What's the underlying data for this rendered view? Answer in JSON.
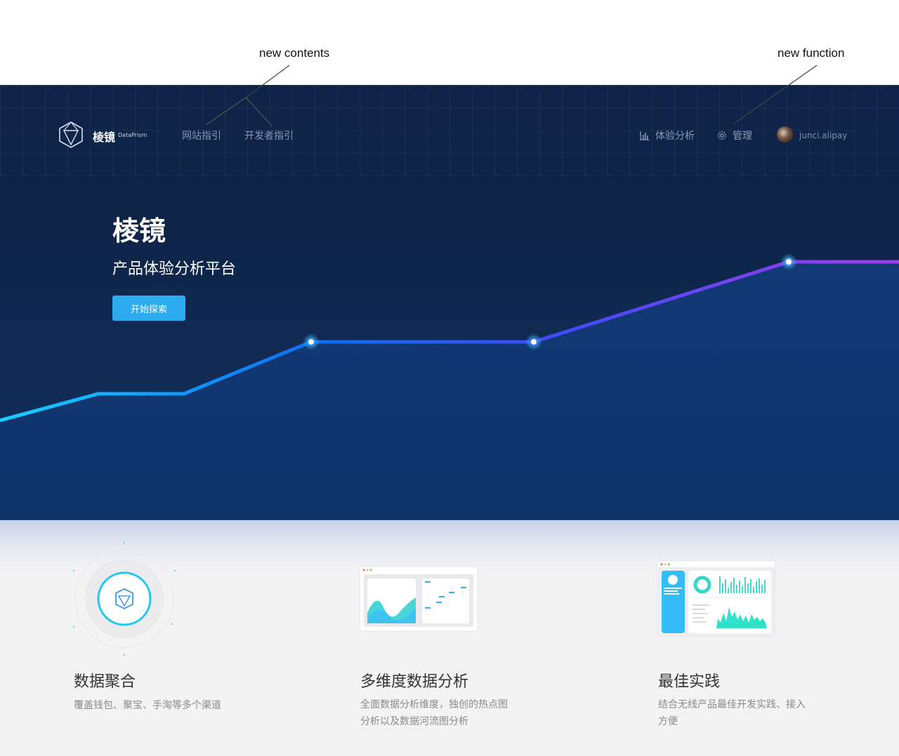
{
  "annotations": {
    "left": "new contents",
    "right": "new function"
  },
  "nav": {
    "brand": "棱镜",
    "brand_sub": "DataPrism",
    "links": [
      "网站指引",
      "开发者指引"
    ],
    "analytics_label": "体验分析",
    "manage_label": "管理",
    "user": "junci.alipay"
  },
  "hero": {
    "title": "棱镜",
    "subtitle": "产品体验分析平台",
    "cta": "开始探索"
  },
  "features": [
    {
      "title": "数据聚合",
      "desc": "覆盖钱包、聚宝、手淘等多个渠道"
    },
    {
      "title": "多维度数据分析",
      "desc1": "全面数据分析维度，独创的热点图",
      "desc2": "分析以及数据河流图分析"
    },
    {
      "title": "最佳实践",
      "desc1": "结合无线产品最佳开发实践、接入",
      "desc2": "方便"
    }
  ],
  "colors": {
    "hero_bg": "#0f2448",
    "accent": "#2eaaf0",
    "line_start": "#19d0ff",
    "line_end": "#a23cf0"
  },
  "icons": [
    "prism-logo-icon",
    "bar-chart-icon",
    "gear-icon",
    "avatar"
  ]
}
